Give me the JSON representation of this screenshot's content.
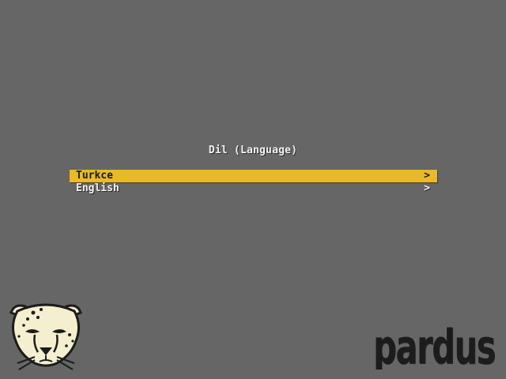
{
  "menu": {
    "title": "Dil (Language)",
    "items": [
      {
        "label": "Turkce",
        "arrow": ">",
        "selected": true
      },
      {
        "label": "English",
        "arrow": ">",
        "selected": false
      }
    ]
  },
  "branding": {
    "mascot_icon": "cheetah-head-icon",
    "logo_text": "pardus"
  },
  "colors": {
    "background": "#666666",
    "selection": "#eab92a",
    "text": "#f2f2f2",
    "selected_text": "#1a1a1a",
    "mascot_fill": "#f4efcf",
    "logo": "#1c1c1c"
  }
}
